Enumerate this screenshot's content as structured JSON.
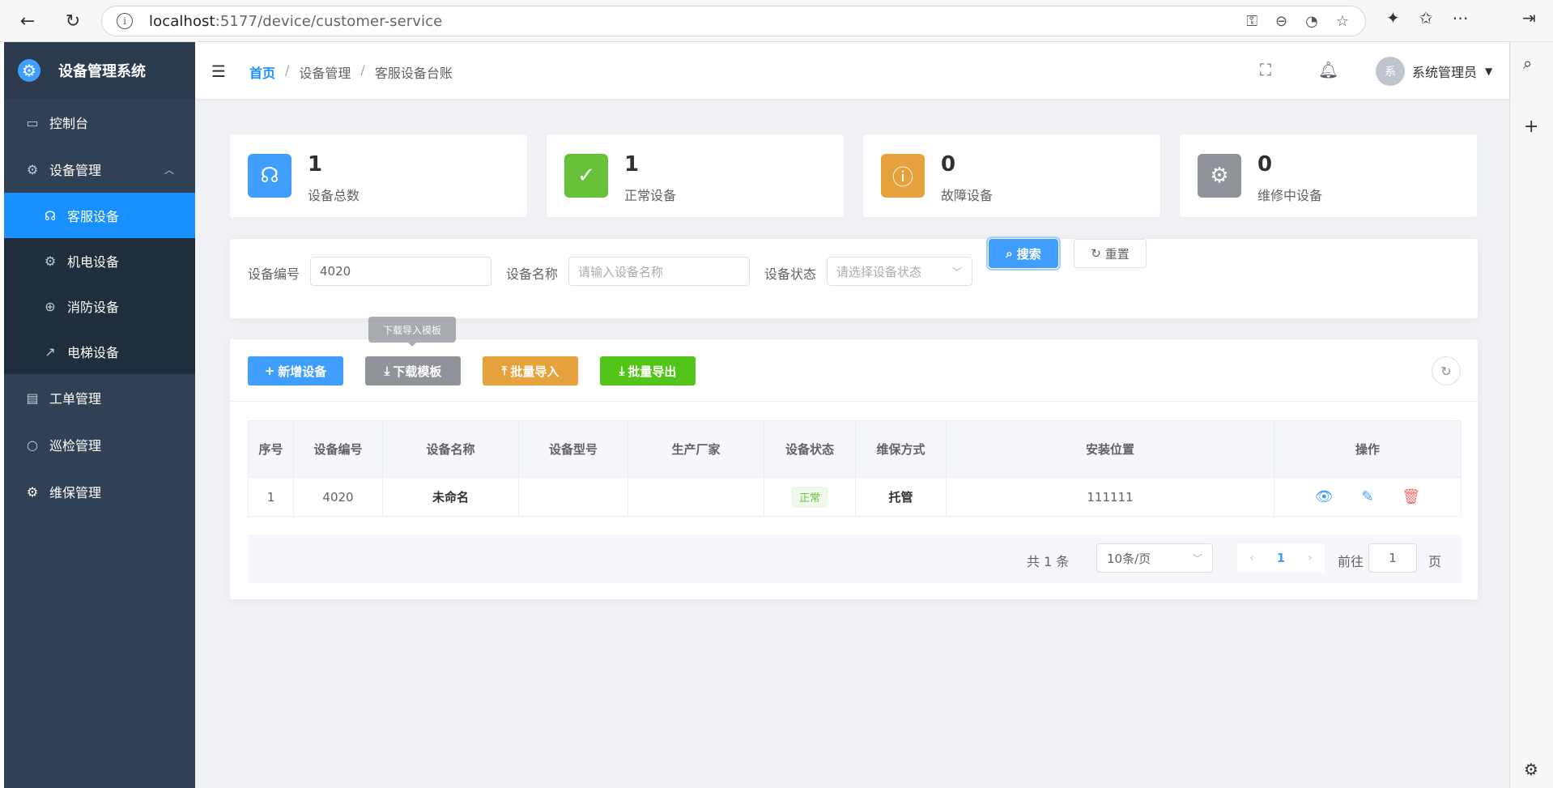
{
  "browser": {
    "url_host": "localhost",
    "url_rest": ":5177/device/customer-service"
  },
  "app": {
    "title": "设备管理系统"
  },
  "sidebar": {
    "items": [
      {
        "label": "控制台"
      },
      {
        "label": "设备管理"
      },
      {
        "label": "客服设备"
      },
      {
        "label": "机电设备"
      },
      {
        "label": "消防设备"
      },
      {
        "label": "电梯设备"
      },
      {
        "label": "工单管理"
      },
      {
        "label": "巡检管理"
      },
      {
        "label": "维保管理"
      }
    ]
  },
  "header": {
    "breadcrumb": [
      "首页",
      "设备管理",
      "客服设备台账"
    ],
    "user_initial": "系",
    "user_name": "系统管理员"
  },
  "stats": [
    {
      "value": "1",
      "label": "设备总数",
      "color": "#409eff"
    },
    {
      "value": "1",
      "label": "正常设备",
      "color": "#67c23a"
    },
    {
      "value": "0",
      "label": "故障设备",
      "color": "#e6a23c"
    },
    {
      "value": "0",
      "label": "维修中设备",
      "color": "#909399"
    }
  ],
  "search": {
    "code_label": "设备编号",
    "code_value": "4020",
    "name_label": "设备名称",
    "name_placeholder": "请输入设备名称",
    "status_label": "设备状态",
    "status_placeholder": "请选择设备状态",
    "search_btn": "搜索",
    "reset_btn": "重置"
  },
  "toolbar": {
    "add": "新增设备",
    "download": "下载模板",
    "import": "批量导入",
    "export": "批量导出",
    "tooltip": "下载导入模板"
  },
  "table": {
    "columns": [
      "序号",
      "设备编号",
      "设备名称",
      "设备型号",
      "生产厂家",
      "设备状态",
      "维保方式",
      "安装位置",
      "操作"
    ],
    "rows": [
      {
        "index": "1",
        "code": "4020",
        "name": "未命名",
        "model": "",
        "maker": "",
        "status": "正常",
        "maint": "托管",
        "location": "111111"
      }
    ]
  },
  "pagination": {
    "total": "共 1 条",
    "page_size": "10条/页",
    "current": "1",
    "goto_label": "前往",
    "goto_value": "1",
    "page_suffix": "页"
  }
}
